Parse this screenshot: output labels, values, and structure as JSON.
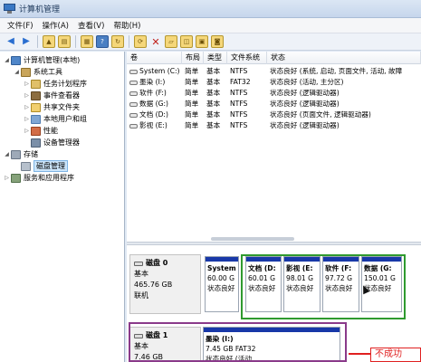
{
  "window": {
    "title": "计算机管理"
  },
  "menu": [
    "文件(F)",
    "操作(A)",
    "查看(V)",
    "帮助(H)"
  ],
  "toolbar_icons": [
    "back-arrow-icon",
    "forward-arrow-icon",
    "up-folder-icon",
    "show-tree-icon",
    "properties-icon",
    "help-icon",
    "refresh-icon",
    "delete-icon",
    "open-icon",
    "save-icon",
    "disk-icon"
  ],
  "tree": [
    {
      "label": "计算机管理(本地)",
      "icon": "computer-icon",
      "indent": 0,
      "exp": "◢"
    },
    {
      "label": "系统工具",
      "icon": "tools-icon",
      "indent": 1,
      "exp": "◢"
    },
    {
      "label": "任务计划程序",
      "icon": "task-scheduler-icon",
      "indent": 2,
      "exp": "▷"
    },
    {
      "label": "事件查看器",
      "icon": "event-viewer-icon",
      "indent": 2,
      "exp": "▷"
    },
    {
      "label": "共享文件夹",
      "icon": "shared-folder-icon",
      "indent": 2,
      "exp": "▷"
    },
    {
      "label": "本地用户和组",
      "icon": "users-icon",
      "indent": 2,
      "exp": "▷"
    },
    {
      "label": "性能",
      "icon": "performance-icon",
      "indent": 2,
      "exp": "▷"
    },
    {
      "label": "设备管理器",
      "icon": "device-manager-icon",
      "indent": 2,
      "exp": ""
    },
    {
      "label": "存储",
      "icon": "storage-icon",
      "indent": 0,
      "exp": "◢"
    },
    {
      "label": "磁盘管理",
      "icon": "disk-management-icon",
      "indent": 1,
      "exp": "",
      "selected": true
    },
    {
      "label": "服务和应用程序",
      "icon": "services-icon",
      "indent": 0,
      "exp": "▷"
    }
  ],
  "volume_columns": [
    "卷",
    "布局",
    "类型",
    "文件系统",
    "状态"
  ],
  "volumes": [
    {
      "name": "System (C:)",
      "layout": "简单",
      "type": "基本",
      "fs": "NTFS",
      "status": "状态良好 (系统, 启动, 页面文件, 活动, 故障"
    },
    {
      "name": "墨染 (I:)",
      "layout": "简单",
      "type": "基本",
      "fs": "FAT32",
      "status": "状态良好 (活动, 主分区)"
    },
    {
      "name": "软件 (F:)",
      "layout": "简单",
      "type": "基本",
      "fs": "NTFS",
      "status": "状态良好 (逻辑驱动器)"
    },
    {
      "name": "数据 (G:)",
      "layout": "简单",
      "type": "基本",
      "fs": "NTFS",
      "status": "状态良好 (逻辑驱动器)"
    },
    {
      "name": "文档 (D:)",
      "layout": "简单",
      "type": "基本",
      "fs": "NTFS",
      "status": "状态良好 (页面文件, 逻辑驱动器)"
    },
    {
      "name": "影视 (E:)",
      "layout": "简单",
      "type": "基本",
      "fs": "NTFS",
      "status": "状态良好 (逻辑驱动器)"
    }
  ],
  "disks": [
    {
      "name": "磁盘 0",
      "type": "基本",
      "size": "465.76 GB",
      "state": "联机",
      "partitions": [
        {
          "title": "System",
          "size": "60.00 G",
          "status": "状态良好",
          "kind": "primary"
        },
        {
          "title": "文档 (D:",
          "size": "60.01 G",
          "status": "状态良好",
          "kind": "logical"
        },
        {
          "title": "影视 (E:",
          "size": "98.01 G",
          "status": "状态良好",
          "kind": "logical"
        },
        {
          "title": "软件 (F:",
          "size": "97.72 G",
          "status": "状态良好",
          "kind": "logical"
        },
        {
          "title": "数据 (G:",
          "size": "150.01 G",
          "status": "状态良好",
          "kind": "logical"
        }
      ]
    },
    {
      "name": "磁盘 1",
      "type": "基本",
      "size": "7.46 GB",
      "state": "",
      "partitions": [
        {
          "title": "墨染 (I:)",
          "size": "7.45 GB FAT32",
          "status": "状态良好 (活动,",
          "kind": "primary"
        }
      ]
    }
  ],
  "annotation": {
    "fail_text": "不成功"
  }
}
